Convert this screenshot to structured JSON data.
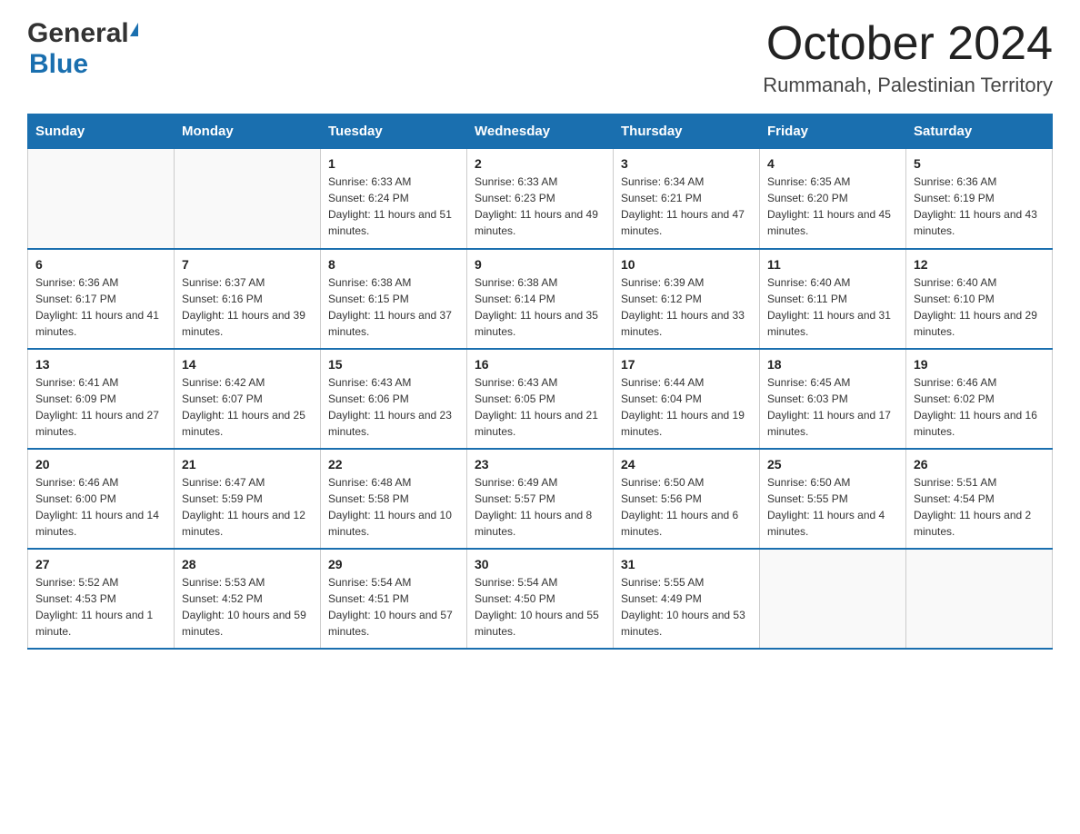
{
  "header": {
    "logo_general": "General",
    "logo_blue": "Blue",
    "month_title": "October 2024",
    "location": "Rummanah, Palestinian Territory"
  },
  "weekdays": [
    "Sunday",
    "Monday",
    "Tuesday",
    "Wednesday",
    "Thursday",
    "Friday",
    "Saturday"
  ],
  "weeks": [
    [
      {
        "day": "",
        "sunrise": "",
        "sunset": "",
        "daylight": ""
      },
      {
        "day": "",
        "sunrise": "",
        "sunset": "",
        "daylight": ""
      },
      {
        "day": "1",
        "sunrise": "Sunrise: 6:33 AM",
        "sunset": "Sunset: 6:24 PM",
        "daylight": "Daylight: 11 hours and 51 minutes."
      },
      {
        "day": "2",
        "sunrise": "Sunrise: 6:33 AM",
        "sunset": "Sunset: 6:23 PM",
        "daylight": "Daylight: 11 hours and 49 minutes."
      },
      {
        "day": "3",
        "sunrise": "Sunrise: 6:34 AM",
        "sunset": "Sunset: 6:21 PM",
        "daylight": "Daylight: 11 hours and 47 minutes."
      },
      {
        "day": "4",
        "sunrise": "Sunrise: 6:35 AM",
        "sunset": "Sunset: 6:20 PM",
        "daylight": "Daylight: 11 hours and 45 minutes."
      },
      {
        "day": "5",
        "sunrise": "Sunrise: 6:36 AM",
        "sunset": "Sunset: 6:19 PM",
        "daylight": "Daylight: 11 hours and 43 minutes."
      }
    ],
    [
      {
        "day": "6",
        "sunrise": "Sunrise: 6:36 AM",
        "sunset": "Sunset: 6:17 PM",
        "daylight": "Daylight: 11 hours and 41 minutes."
      },
      {
        "day": "7",
        "sunrise": "Sunrise: 6:37 AM",
        "sunset": "Sunset: 6:16 PM",
        "daylight": "Daylight: 11 hours and 39 minutes."
      },
      {
        "day": "8",
        "sunrise": "Sunrise: 6:38 AM",
        "sunset": "Sunset: 6:15 PM",
        "daylight": "Daylight: 11 hours and 37 minutes."
      },
      {
        "day": "9",
        "sunrise": "Sunrise: 6:38 AM",
        "sunset": "Sunset: 6:14 PM",
        "daylight": "Daylight: 11 hours and 35 minutes."
      },
      {
        "day": "10",
        "sunrise": "Sunrise: 6:39 AM",
        "sunset": "Sunset: 6:12 PM",
        "daylight": "Daylight: 11 hours and 33 minutes."
      },
      {
        "day": "11",
        "sunrise": "Sunrise: 6:40 AM",
        "sunset": "Sunset: 6:11 PM",
        "daylight": "Daylight: 11 hours and 31 minutes."
      },
      {
        "day": "12",
        "sunrise": "Sunrise: 6:40 AM",
        "sunset": "Sunset: 6:10 PM",
        "daylight": "Daylight: 11 hours and 29 minutes."
      }
    ],
    [
      {
        "day": "13",
        "sunrise": "Sunrise: 6:41 AM",
        "sunset": "Sunset: 6:09 PM",
        "daylight": "Daylight: 11 hours and 27 minutes."
      },
      {
        "day": "14",
        "sunrise": "Sunrise: 6:42 AM",
        "sunset": "Sunset: 6:07 PM",
        "daylight": "Daylight: 11 hours and 25 minutes."
      },
      {
        "day": "15",
        "sunrise": "Sunrise: 6:43 AM",
        "sunset": "Sunset: 6:06 PM",
        "daylight": "Daylight: 11 hours and 23 minutes."
      },
      {
        "day": "16",
        "sunrise": "Sunrise: 6:43 AM",
        "sunset": "Sunset: 6:05 PM",
        "daylight": "Daylight: 11 hours and 21 minutes."
      },
      {
        "day": "17",
        "sunrise": "Sunrise: 6:44 AM",
        "sunset": "Sunset: 6:04 PM",
        "daylight": "Daylight: 11 hours and 19 minutes."
      },
      {
        "day": "18",
        "sunrise": "Sunrise: 6:45 AM",
        "sunset": "Sunset: 6:03 PM",
        "daylight": "Daylight: 11 hours and 17 minutes."
      },
      {
        "day": "19",
        "sunrise": "Sunrise: 6:46 AM",
        "sunset": "Sunset: 6:02 PM",
        "daylight": "Daylight: 11 hours and 16 minutes."
      }
    ],
    [
      {
        "day": "20",
        "sunrise": "Sunrise: 6:46 AM",
        "sunset": "Sunset: 6:00 PM",
        "daylight": "Daylight: 11 hours and 14 minutes."
      },
      {
        "day": "21",
        "sunrise": "Sunrise: 6:47 AM",
        "sunset": "Sunset: 5:59 PM",
        "daylight": "Daylight: 11 hours and 12 minutes."
      },
      {
        "day": "22",
        "sunrise": "Sunrise: 6:48 AM",
        "sunset": "Sunset: 5:58 PM",
        "daylight": "Daylight: 11 hours and 10 minutes."
      },
      {
        "day": "23",
        "sunrise": "Sunrise: 6:49 AM",
        "sunset": "Sunset: 5:57 PM",
        "daylight": "Daylight: 11 hours and 8 minutes."
      },
      {
        "day": "24",
        "sunrise": "Sunrise: 6:50 AM",
        "sunset": "Sunset: 5:56 PM",
        "daylight": "Daylight: 11 hours and 6 minutes."
      },
      {
        "day": "25",
        "sunrise": "Sunrise: 6:50 AM",
        "sunset": "Sunset: 5:55 PM",
        "daylight": "Daylight: 11 hours and 4 minutes."
      },
      {
        "day": "26",
        "sunrise": "Sunrise: 5:51 AM",
        "sunset": "Sunset: 4:54 PM",
        "daylight": "Daylight: 11 hours and 2 minutes."
      }
    ],
    [
      {
        "day": "27",
        "sunrise": "Sunrise: 5:52 AM",
        "sunset": "Sunset: 4:53 PM",
        "daylight": "Daylight: 11 hours and 1 minute."
      },
      {
        "day": "28",
        "sunrise": "Sunrise: 5:53 AM",
        "sunset": "Sunset: 4:52 PM",
        "daylight": "Daylight: 10 hours and 59 minutes."
      },
      {
        "day": "29",
        "sunrise": "Sunrise: 5:54 AM",
        "sunset": "Sunset: 4:51 PM",
        "daylight": "Daylight: 10 hours and 57 minutes."
      },
      {
        "day": "30",
        "sunrise": "Sunrise: 5:54 AM",
        "sunset": "Sunset: 4:50 PM",
        "daylight": "Daylight: 10 hours and 55 minutes."
      },
      {
        "day": "31",
        "sunrise": "Sunrise: 5:55 AM",
        "sunset": "Sunset: 4:49 PM",
        "daylight": "Daylight: 10 hours and 53 minutes."
      },
      {
        "day": "",
        "sunrise": "",
        "sunset": "",
        "daylight": ""
      },
      {
        "day": "",
        "sunrise": "",
        "sunset": "",
        "daylight": ""
      }
    ]
  ]
}
